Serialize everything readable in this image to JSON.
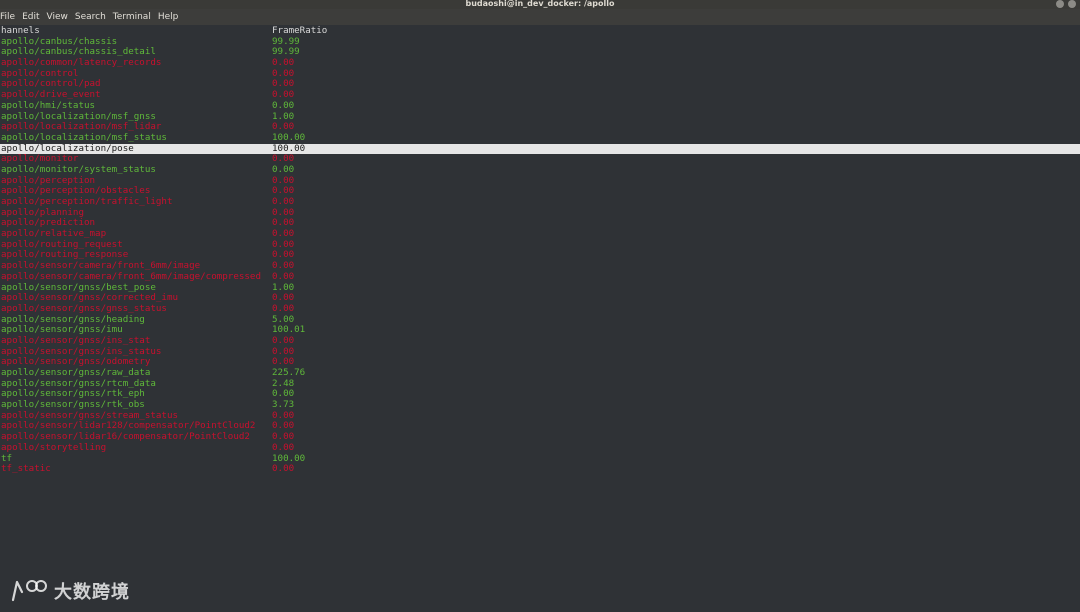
{
  "window": {
    "title": "budaoshi@in_dev_docker: /apollo"
  },
  "menu": [
    "File",
    "Edit",
    "View",
    "Search",
    "Terminal",
    "Help"
  ],
  "columns": {
    "channels": "hannels",
    "frame_ratio": "FrameRatio"
  },
  "colors": {
    "ok": "#5fb83a",
    "bad": "#c8102e",
    "selected_bg": "#e6e6e6"
  },
  "rows": [
    {
      "channel": "apollo/canbus/chassis",
      "ratio": "99.99",
      "status": "ok"
    },
    {
      "channel": "apollo/canbus/chassis_detail",
      "ratio": "99.99",
      "status": "ok"
    },
    {
      "channel": "apollo/common/latency_records",
      "ratio": "0.00",
      "status": "bad"
    },
    {
      "channel": "apollo/control",
      "ratio": "0.00",
      "status": "bad"
    },
    {
      "channel": "apollo/control/pad",
      "ratio": "0.00",
      "status": "bad"
    },
    {
      "channel": "apollo/drive_event",
      "ratio": "0.00",
      "status": "bad"
    },
    {
      "channel": "apollo/hmi/status",
      "ratio": "0.00",
      "status": "ok"
    },
    {
      "channel": "apollo/localization/msf_gnss",
      "ratio": "1.00",
      "status": "ok"
    },
    {
      "channel": "apollo/localization/msf_lidar",
      "ratio": "0.00",
      "status": "bad"
    },
    {
      "channel": "apollo/localization/msf_status",
      "ratio": "100.00",
      "status": "ok"
    },
    {
      "channel": "apollo/localization/pose",
      "ratio": "100.00",
      "status": "selected"
    },
    {
      "channel": "apollo/monitor",
      "ratio": "0.00",
      "status": "bad"
    },
    {
      "channel": "apollo/monitor/system_status",
      "ratio": "0.00",
      "status": "ok"
    },
    {
      "channel": "apollo/perception",
      "ratio": "0.00",
      "status": "bad"
    },
    {
      "channel": "apollo/perception/obstacles",
      "ratio": "0.00",
      "status": "bad"
    },
    {
      "channel": "apollo/perception/traffic_light",
      "ratio": "0.00",
      "status": "bad"
    },
    {
      "channel": "apollo/planning",
      "ratio": "0.00",
      "status": "bad"
    },
    {
      "channel": "apollo/prediction",
      "ratio": "0.00",
      "status": "bad"
    },
    {
      "channel": "apollo/relative_map",
      "ratio": "0.00",
      "status": "bad"
    },
    {
      "channel": "apollo/routing_request",
      "ratio": "0.00",
      "status": "bad"
    },
    {
      "channel": "apollo/routing_response",
      "ratio": "0.00",
      "status": "bad"
    },
    {
      "channel": "apollo/sensor/camera/front_6mm/image",
      "ratio": "0.00",
      "status": "bad"
    },
    {
      "channel": "apollo/sensor/camera/front_6mm/image/compressed",
      "ratio": "0.00",
      "status": "bad"
    },
    {
      "channel": "apollo/sensor/gnss/best_pose",
      "ratio": "1.00",
      "status": "ok"
    },
    {
      "channel": "apollo/sensor/gnss/corrected_imu",
      "ratio": "0.00",
      "status": "bad"
    },
    {
      "channel": "apollo/sensor/gnss/gnss_status",
      "ratio": "0.00",
      "status": "bad"
    },
    {
      "channel": "apollo/sensor/gnss/heading",
      "ratio": "5.00",
      "status": "ok"
    },
    {
      "channel": "apollo/sensor/gnss/imu",
      "ratio": "100.01",
      "status": "ok"
    },
    {
      "channel": "apollo/sensor/gnss/ins_stat",
      "ratio": "0.00",
      "status": "bad"
    },
    {
      "channel": "apollo/sensor/gnss/ins_status",
      "ratio": "0.00",
      "status": "bad"
    },
    {
      "channel": "apollo/sensor/gnss/odometry",
      "ratio": "0.00",
      "status": "bad"
    },
    {
      "channel": "apollo/sensor/gnss/raw_data",
      "ratio": "225.76",
      "status": "ok"
    },
    {
      "channel": "apollo/sensor/gnss/rtcm_data",
      "ratio": "2.48",
      "status": "ok"
    },
    {
      "channel": "apollo/sensor/gnss/rtk_eph",
      "ratio": "0.00",
      "status": "ok"
    },
    {
      "channel": "apollo/sensor/gnss/rtk_obs",
      "ratio": "3.73",
      "status": "ok"
    },
    {
      "channel": "apollo/sensor/gnss/stream_status",
      "ratio": "0.00",
      "status": "bad"
    },
    {
      "channel": "apollo/sensor/lidar128/compensator/PointCloud2",
      "ratio": "0.00",
      "status": "bad"
    },
    {
      "channel": "apollo/sensor/lidar16/compensator/PointCloud2",
      "ratio": "0.00",
      "status": "bad"
    },
    {
      "channel": "apollo/storytelling",
      "ratio": "0.00",
      "status": "bad"
    },
    {
      "channel": "tf",
      "ratio": "100.00",
      "status": "ok"
    },
    {
      "channel": "tf_static",
      "ratio": "0.00",
      "status": "bad"
    }
  ],
  "watermark": {
    "text": "大数跨境"
  }
}
